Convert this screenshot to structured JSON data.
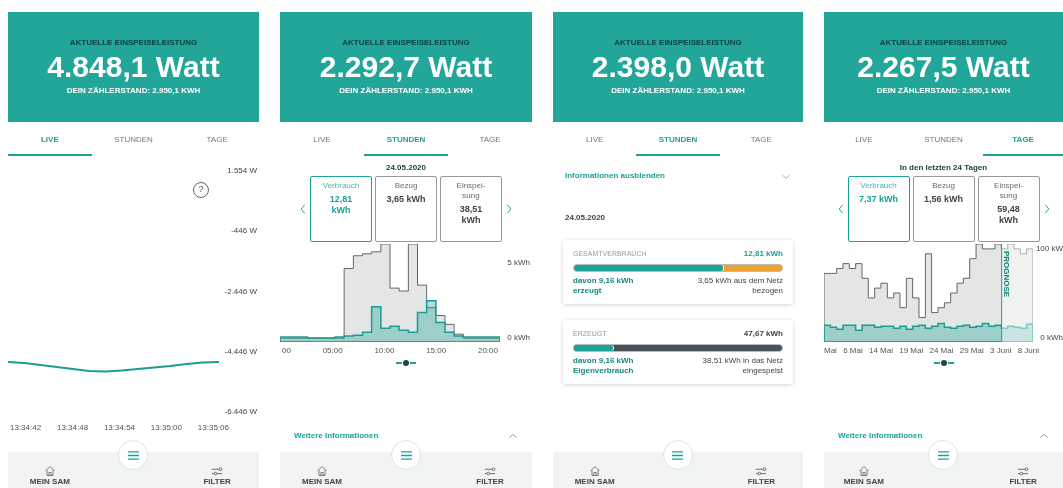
{
  "screens": [
    {
      "kind": "live",
      "header": {
        "label": "AKTUELLE EINSPEISELEISTUNG",
        "value": "4.848,1 Watt",
        "meter": "DEIN ZÄHLERSTAND: 2.950,1 KWH"
      },
      "tabs": [
        {
          "label": "LIVE",
          "selected": true
        },
        {
          "label": "STUNDEN",
          "selected": false
        },
        {
          "label": "TAGE",
          "selected": false
        }
      ],
      "help_button": "?",
      "y_labels": [
        "1.554 W",
        "-446 W",
        "-2.446 W",
        "-4.446 W",
        "-6.446 W"
      ],
      "x_labels": [
        "13:34:42",
        "13:34:48",
        "13:34:54",
        "13:35:00",
        "13:35:06"
      ],
      "nav": {
        "home": "MEIN SAM",
        "filter": "FILTER"
      }
    },
    {
      "kind": "hours",
      "header": {
        "label": "AKTUELLE EINSPEISELEISTUNG",
        "value": "2.292,7 Watt",
        "meter": "DEIN ZÄHLERSTAND: 2.950,1 KWH"
      },
      "tabs": [
        {
          "label": "LIVE",
          "selected": false
        },
        {
          "label": "STUNDEN",
          "selected": true
        },
        {
          "label": "TAGE",
          "selected": false
        }
      ],
      "period": "24.05.2020",
      "cards": [
        {
          "label": "Verbrauch",
          "value": "12,81\nkWh",
          "selected": true
        },
        {
          "label": "Bezug",
          "value": "3,65 kWh",
          "selected": false
        },
        {
          "label": "Einspei-\nsung",
          "value": "38,51\nkWh",
          "selected": false
        }
      ],
      "y_labels": [
        "5 kWh",
        "0 kWh"
      ],
      "x_labels": [
        "00",
        "05:00",
        "10:00",
        "15:00",
        "20:00"
      ],
      "more": "Weitere Informationen",
      "nav": {
        "home": "MEIN SAM",
        "filter": "FILTER"
      }
    },
    {
      "kind": "info",
      "header": {
        "label": "AKTUELLE EINSPEISELEISTUNG",
        "value": "2.398,0 Watt",
        "meter": "DEIN ZÄHLERSTAND: 2.950,1 KWH"
      },
      "tabs": [
        {
          "label": "LIVE",
          "selected": false
        },
        {
          "label": "STUNDEN",
          "selected": true
        },
        {
          "label": "TAGE",
          "selected": false
        }
      ],
      "hide": "Informationen ausblenden",
      "date": "24.05.2020",
      "summaries": [
        {
          "title": "GESAMTVERBRAUCH",
          "total": "12,81 kWh",
          "level": 0.72,
          "color": "#f0a331",
          "left": "davon 9,16 kWh\nerzeugt",
          "right": "3,65 kWh aus dem Netz\nbezogen"
        },
        {
          "title": "ERZEUGT",
          "total": "47,67 kWh",
          "level": 0.19,
          "color": "#4a5257",
          "left": "davon 9,16 kWh\nEigenverbrauch",
          "right": "38,51 kWh in das Netz\neingespeist"
        }
      ],
      "nav": {
        "home": "MEIN SAM",
        "filter": "FILTER"
      }
    },
    {
      "kind": "days",
      "header": {
        "label": "AKTUELLE EINSPEISELEISTUNG",
        "value": "2.267,5 Watt",
        "meter": "DEIN ZÄHLERSTAND: 2.950,1 KWH"
      },
      "tabs": [
        {
          "label": "LIVE",
          "selected": false
        },
        {
          "label": "STUNDEN",
          "selected": false
        },
        {
          "label": "TAGE",
          "selected": true
        }
      ],
      "period": "In den letzten 24 Tagen",
      "cards": [
        {
          "label": "Verbrauch",
          "value": "7,37 kWh",
          "selected": true
        },
        {
          "label": "Bezug",
          "value": "1,56 kWh",
          "selected": false
        },
        {
          "label": "Einspei-\nsung",
          "value": "59,48\nkWh",
          "selected": false
        }
      ],
      "forecast_label": "PROGNOSE",
      "y_labels": [
        "100 kW",
        "0 kWh"
      ],
      "x_labels": [
        "Mai",
        "6 Mai",
        "14 Mai",
        "19 Mai",
        "24 Mai",
        "29 Mai",
        "3 Juni",
        "8 Juni"
      ],
      "more": "Weitere Informationen",
      "nav": {
        "home": "MEIN SAM",
        "filter": "FILTER"
      }
    }
  ]
}
